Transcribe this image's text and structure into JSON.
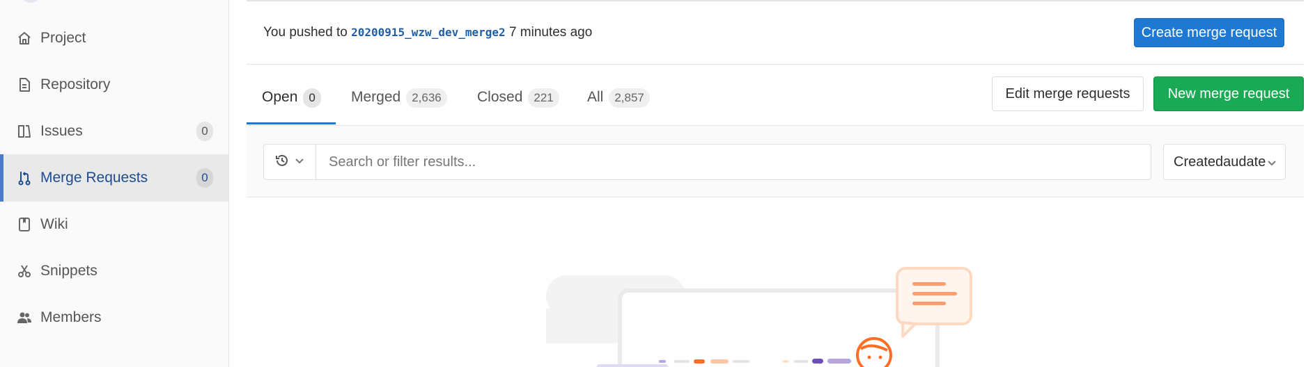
{
  "sidebar": {
    "items": [
      {
        "label": "Project",
        "icon": "home-icon",
        "count": null,
        "active": false
      },
      {
        "label": "Repository",
        "icon": "document-icon",
        "count": null,
        "active": false
      },
      {
        "label": "Issues",
        "icon": "issues-icon",
        "count": "0",
        "active": false
      },
      {
        "label": "Merge Requests",
        "icon": "merge-request-icon",
        "count": "0",
        "active": true
      },
      {
        "label": "Wiki",
        "icon": "book-icon",
        "count": null,
        "active": false
      },
      {
        "label": "Snippets",
        "icon": "scissors-icon",
        "count": null,
        "active": false
      },
      {
        "label": "Members",
        "icon": "users-icon",
        "count": null,
        "active": false
      }
    ]
  },
  "banner": {
    "prefix": "You pushed to",
    "branch": "20200915_wzw_dev_merge2",
    "suffix": "7 minutes ago",
    "create_button": "Create merge request"
  },
  "tabs": [
    {
      "label": "Open",
      "count": "0",
      "active": true
    },
    {
      "label": "Merged",
      "count": "2,636",
      "active": false
    },
    {
      "label": "Closed",
      "count": "221",
      "active": false
    },
    {
      "label": "All",
      "count": "2,857",
      "active": false
    }
  ],
  "actions": {
    "edit": "Edit merge requests",
    "new": "New merge request"
  },
  "filter": {
    "history_icon": "history-icon",
    "placeholder": "Search or filter results...",
    "sort_label": "Createdaudate"
  },
  "colors": {
    "primary_blue": "#1f78d1",
    "success_green": "#1aaa55",
    "active_nav": "#1f4c8f",
    "illustration_orange": "#fc6d26",
    "illustration_purple": "#6b4fbb"
  }
}
